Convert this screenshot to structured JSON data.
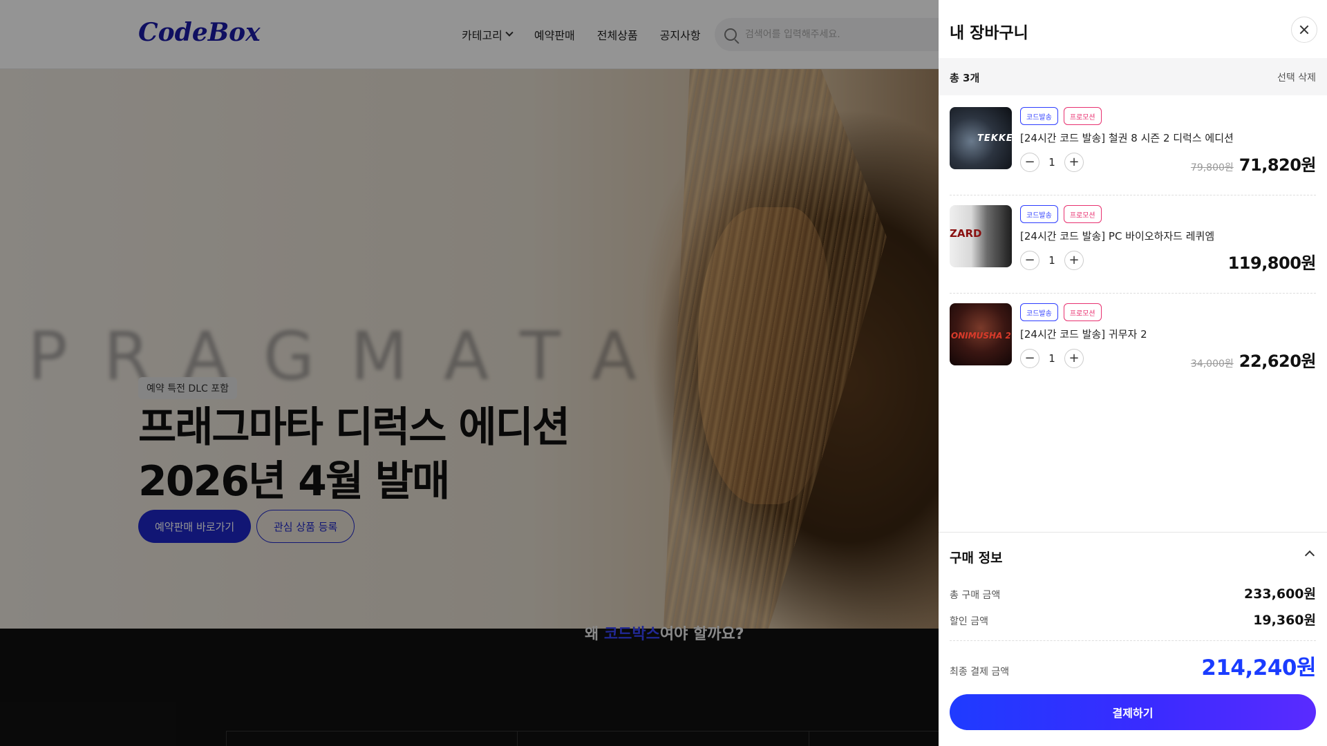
{
  "header": {
    "logo": "CodeBox",
    "nav": [
      "카테고리",
      "예약판매",
      "전체상품",
      "공지사항"
    ],
    "search_placeholder": "검색어를 입력해주세요."
  },
  "hero": {
    "watermark": "PRAGMATA",
    "tag": "예약 특전 DLC 포함",
    "title_line1": "프래그마타 디럭스 에디션",
    "title_line2": "2026년 4월 발매",
    "primary_button": "예약판매 바로가기",
    "secondary_button": "관심 상품 등록"
  },
  "section": {
    "why_prefix": "왜 ",
    "why_highlight": "코드박스",
    "why_suffix": "여야 할까요?"
  },
  "cart": {
    "title": "내 장바구니",
    "total_count": "총 3개",
    "delete_selected": "선택 삭제",
    "items": [
      {
        "badges": [
          "코드발송",
          "프로모션"
        ],
        "name": "[24시간 코드 발송] 철권 8 시즌 2 디럭스 에디션",
        "qty": "1",
        "original_price": "79,800원",
        "price": "71,820원",
        "thumb_text": "TEKKEN"
      },
      {
        "badges": [
          "코드발송",
          "프로모션"
        ],
        "name": "[24시간 코드 발송] PC 바이오하자드 레퀴엠",
        "qty": "1",
        "original_price": "",
        "price": "119,800원",
        "thumb_text": "ZARD"
      },
      {
        "badges": [
          "코드발송",
          "프로모션"
        ],
        "name": "[24시간 코드 발송] 귀무자 2",
        "qty": "1",
        "original_price": "34,000원",
        "price": "22,620원",
        "thumb_text": "ONIMUSHA 2"
      }
    ],
    "purchase_info": {
      "title": "구매 정보",
      "total_label": "총 구매 금액",
      "total_value": "233,600원",
      "discount_label": "할인 금액",
      "discount_value": "19,360원",
      "final_label": "최종 결제 금액",
      "final_value": "214,240원"
    },
    "checkout_button": "결제하기"
  },
  "colors": {
    "brand": "#1e26c8",
    "accent_blue": "#1a3cff",
    "promo_pink": "#e8306f"
  }
}
